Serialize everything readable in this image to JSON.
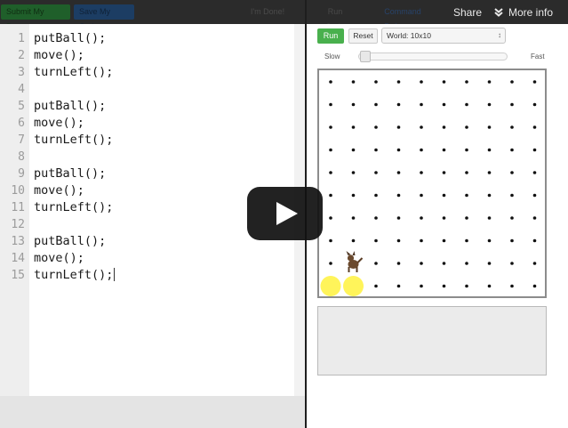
{
  "toolbar": {
    "submit_label": "Submit My Program",
    "save_label": "Save My Code",
    "done_label": "I'm Done!",
    "run_code_tab": "Run Code",
    "command_reference_tab": "Command Reference"
  },
  "player": {
    "share_label": "Share",
    "more_info_label": "More info"
  },
  "editor": {
    "lines": [
      {
        "num": "1",
        "code": "putBall();"
      },
      {
        "num": "2",
        "code": "move();"
      },
      {
        "num": "3",
        "code": "turnLeft();"
      },
      {
        "num": "4",
        "code": ""
      },
      {
        "num": "5",
        "code": "putBall();"
      },
      {
        "num": "6",
        "code": "move();"
      },
      {
        "num": "7",
        "code": "turnLeft();"
      },
      {
        "num": "8",
        "code": ""
      },
      {
        "num": "9",
        "code": "putBall();"
      },
      {
        "num": "10",
        "code": "move();"
      },
      {
        "num": "11",
        "code": "turnLeft();"
      },
      {
        "num": "12",
        "code": ""
      },
      {
        "num": "13",
        "code": "putBall();"
      },
      {
        "num": "14",
        "code": "move();"
      },
      {
        "num": "15",
        "code": "turnLeft();"
      }
    ]
  },
  "controls": {
    "run_label": "Run",
    "reset_label": "Reset",
    "world_value": "World: 10x10",
    "slow_label": "Slow",
    "fast_label": "Fast",
    "speed_fraction": 0.0
  },
  "world": {
    "cols": 10,
    "rows": 10,
    "karel_col": 2,
    "karel_row": 2,
    "balls": [
      {
        "col": 1,
        "row": 1
      },
      {
        "col": 2,
        "row": 1
      }
    ],
    "ball_color": "#fff45a",
    "karel_icon": "dog-icon"
  },
  "colors": {
    "run_green": "#49b04d",
    "play_black": "#111111"
  }
}
